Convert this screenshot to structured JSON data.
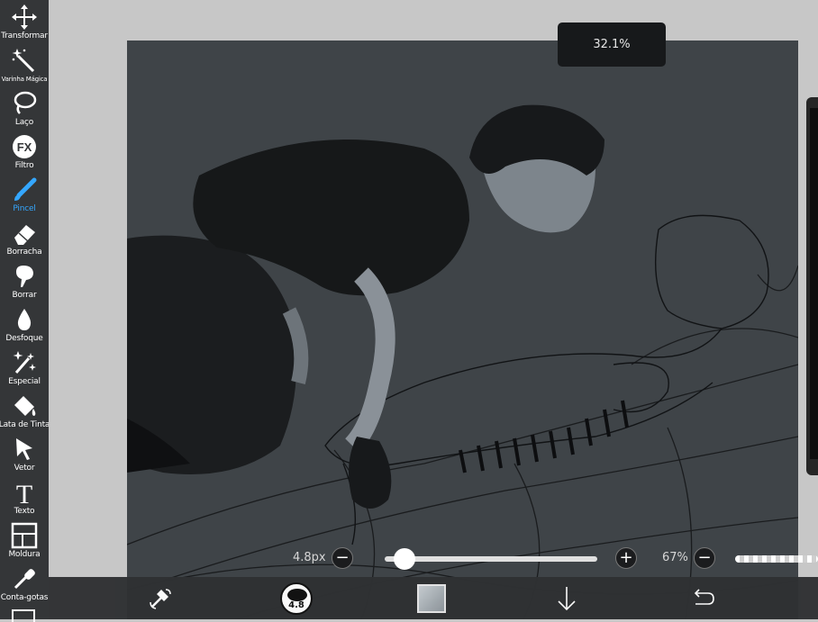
{
  "toolbar": {
    "tools": [
      {
        "label": "Transformar",
        "icon": "move-arrows-icon"
      },
      {
        "label": "Varinha Mágica",
        "icon": "magic-wand-icon"
      },
      {
        "label": "Laço",
        "icon": "lasso-icon"
      },
      {
        "label": "Filtro",
        "icon": "fx-filter-icon",
        "icon_text": "FX"
      },
      {
        "label": "Pincel",
        "icon": "brush-icon",
        "active": true
      },
      {
        "label": "Borracha",
        "icon": "eraser-icon"
      },
      {
        "label": "Borrar",
        "icon": "smudge-icon"
      },
      {
        "label": "Desfoque",
        "icon": "blur-drop-icon"
      },
      {
        "label": "Especial",
        "icon": "special-sparkle-icon"
      },
      {
        "label": "Lata de Tinta",
        "icon": "paint-bucket-icon"
      },
      {
        "label": "Vetor",
        "icon": "vector-cursor-icon"
      },
      {
        "label": "Texto",
        "icon": "text-t-icon",
        "icon_text": "T"
      },
      {
        "label": "Moldura",
        "icon": "frame-icon"
      },
      {
        "label": "Conta-gotas",
        "icon": "eyedropper-icon"
      }
    ],
    "active_color": "#34a7ff"
  },
  "canvas": {
    "zoom": "32.1%",
    "background_color": "#3f4448"
  },
  "brush_controls": {
    "size_value": "4.8px",
    "size_level": 0.05,
    "opacity_value": "67%",
    "minus_symbol": "−",
    "plus_symbol": "+"
  },
  "bottom_bar": {
    "swap_tool_icon": "brush-eraser-swap-icon",
    "brush_size_badge": "4.8",
    "color_icon": "color-swatch-icon",
    "layer_icon": "arrow-down-icon",
    "undo_icon": "undo-icon"
  }
}
